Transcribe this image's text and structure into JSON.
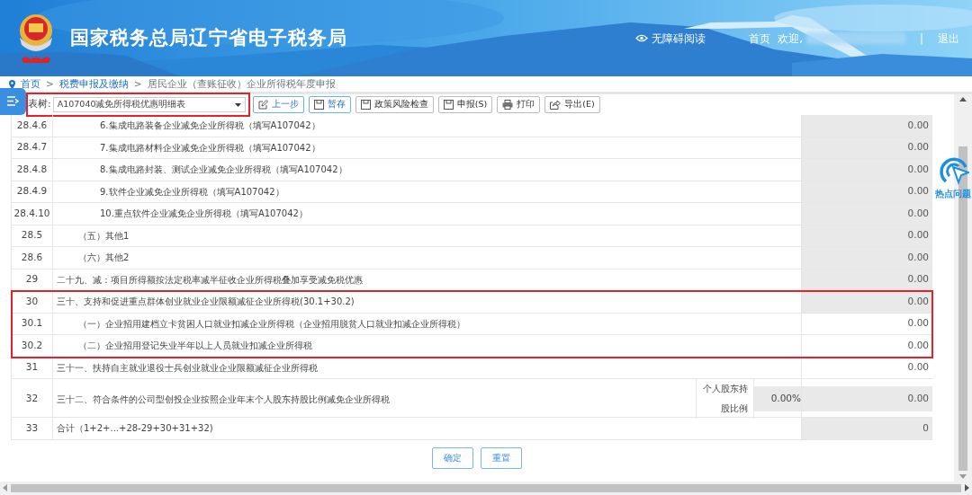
{
  "header": {
    "title": "国家税务总局辽宁省电子税务局",
    "accessibility_link": "无障碍阅读",
    "home_link": "首页",
    "welcome": "欢迎,",
    "divider": "|",
    "logout": "退出"
  },
  "breadcrumb": {
    "separator": ">",
    "items": [
      {
        "label": "首页",
        "kind": "link"
      },
      {
        "label": "税费申报及缴纳",
        "kind": "link"
      },
      {
        "label": "居民企业（查账征收）企业所得税年度申报",
        "kind": "current"
      }
    ]
  },
  "toolbar": {
    "table_label": "表树:",
    "table_select": {
      "value": "A107040减免所得税优惠明细表",
      "highlighted": true
    },
    "buttons": [
      {
        "label": "上一步",
        "kind": "primary"
      },
      {
        "label": "暂存",
        "kind": "primary"
      },
      {
        "label": "政策风险检查",
        "kind": "default"
      },
      {
        "label": "申报(S)",
        "kind": "default"
      },
      {
        "label": "打印",
        "kind": "default"
      },
      {
        "label": "导出(E)",
        "kind": "default"
      }
    ]
  },
  "table": {
    "rows": [
      {
        "children": [
          {
            "children": [
              {
                "no": "28.4.6",
                "item": "6.集成电路装备企业减免企业所得税（填写A107042）",
                "value": "0.00",
                "editable": false
              },
              {
                "no": "28.4.7",
                "item": "7.集成电路材料企业减免企业所得税（填写A107042）",
                "value": "0.00",
                "editable": false
              },
              {
                "no": "28.4.8",
                "item": "8.集成电路封装、测试企业减免企业所得税（填写A107042）",
                "value": "0.00",
                "editable": false
              },
              {
                "no": "28.4.9",
                "item": "9.软件企业减免企业所得税（填写A107042）",
                "value": "0.00",
                "editable": false
              },
              {
                "no": "28.4.10",
                "item": "10.重点软件企业减免企业所得税（填写A107042）",
                "value": "0.00",
                "editable": false
              }
            ]
          },
          {
            "no": "28.5",
            "item": "（五）其他1",
            "value": "0.00",
            "editable": false
          },
          {
            "no": "28.6",
            "item": "（六）其他2",
            "value": "0.00",
            "editable": false
          }
        ]
      },
      {
        "no": "29",
        "item": "二十九、减：项目所得额按法定税率减半征收企业所得税叠加享受减免税优惠",
        "value": "0.00",
        "editable": false,
        "highlighted": false
      },
      {
        "no": "30",
        "item": "三十、支持和促进重点群体创业就业企业限额减征企业所得税(30.1+30.2)",
        "value": "0.00",
        "editable": false,
        "highlighted": true,
        "children": [
          {
            "no": "30.1",
            "item": "（一）企业招用建档立卡贫困人口就业扣减企业所得税（企业招用脱贫人口就业扣减企业所得税）",
            "value": "0.00",
            "editable": true
          },
          {
            "no": "30.2",
            "item": "（二）企业招用登记失业半年以上人员就业扣减企业所得税",
            "value": "0.00",
            "editable": true
          }
        ]
      },
      {
        "no": "31",
        "item": "三十一、扶持自主就业退役士兵创业就业企业限额减征企业所得税",
        "value": "0.00",
        "editable": true,
        "highlighted": false
      },
      {
        "no": "32",
        "item": "三十二、符合条件的公司型创投企业按照企业年末个人股东持股比例减免企业所得税",
        "value": "0.00",
        "editable": false,
        "highlighted": false,
        "kind": "ratio",
        "ratio_label": "个人股东持股比例",
        "ratio_value": "0.00%"
      },
      {
        "no": "33",
        "item": "合计（1+2+...+28-29+30+31+32)",
        "value": "0",
        "editable": false,
        "highlighted": false
      }
    ]
  },
  "form_buttons": [
    {
      "label": "确定"
    },
    {
      "label": "重置"
    }
  ],
  "hot_topics": {
    "label": "热点问题"
  }
}
